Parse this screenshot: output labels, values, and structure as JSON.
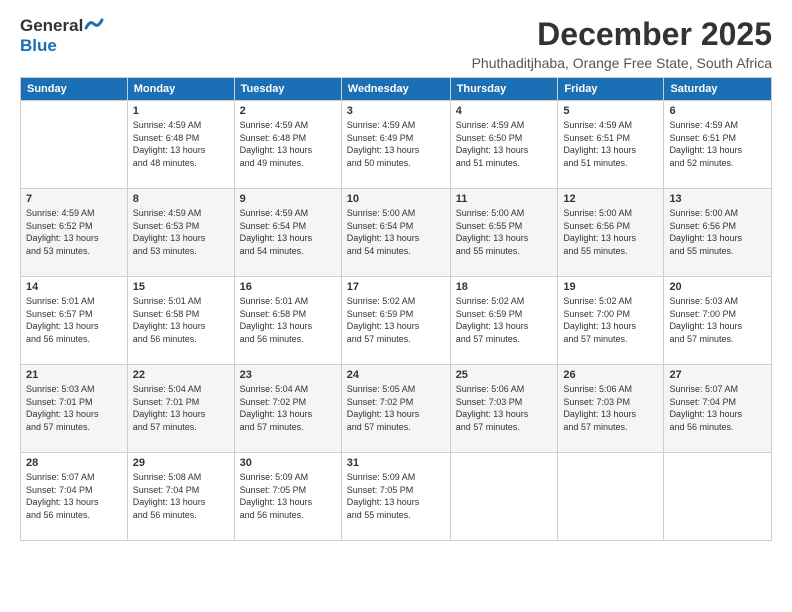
{
  "logo": {
    "general": "General",
    "blue": "Blue"
  },
  "header": {
    "month_year": "December 2025",
    "location": "Phuthaditjhaba, Orange Free State, South Africa"
  },
  "weekdays": [
    "Sunday",
    "Monday",
    "Tuesday",
    "Wednesday",
    "Thursday",
    "Friday",
    "Saturday"
  ],
  "weeks": [
    [
      {
        "day": "",
        "sunrise": "",
        "sunset": "",
        "daylight": ""
      },
      {
        "day": "1",
        "sunrise": "Sunrise: 4:59 AM",
        "sunset": "Sunset: 6:48 PM",
        "daylight": "Daylight: 13 hours and 48 minutes."
      },
      {
        "day": "2",
        "sunrise": "Sunrise: 4:59 AM",
        "sunset": "Sunset: 6:48 PM",
        "daylight": "Daylight: 13 hours and 49 minutes."
      },
      {
        "day": "3",
        "sunrise": "Sunrise: 4:59 AM",
        "sunset": "Sunset: 6:49 PM",
        "daylight": "Daylight: 13 hours and 50 minutes."
      },
      {
        "day": "4",
        "sunrise": "Sunrise: 4:59 AM",
        "sunset": "Sunset: 6:50 PM",
        "daylight": "Daylight: 13 hours and 51 minutes."
      },
      {
        "day": "5",
        "sunrise": "Sunrise: 4:59 AM",
        "sunset": "Sunset: 6:51 PM",
        "daylight": "Daylight: 13 hours and 51 minutes."
      },
      {
        "day": "6",
        "sunrise": "Sunrise: 4:59 AM",
        "sunset": "Sunset: 6:51 PM",
        "daylight": "Daylight: 13 hours and 52 minutes."
      }
    ],
    [
      {
        "day": "7",
        "sunrise": "Sunrise: 4:59 AM",
        "sunset": "Sunset: 6:52 PM",
        "daylight": "Daylight: 13 hours and 53 minutes."
      },
      {
        "day": "8",
        "sunrise": "Sunrise: 4:59 AM",
        "sunset": "Sunset: 6:53 PM",
        "daylight": "Daylight: 13 hours and 53 minutes."
      },
      {
        "day": "9",
        "sunrise": "Sunrise: 4:59 AM",
        "sunset": "Sunset: 6:54 PM",
        "daylight": "Daylight: 13 hours and 54 minutes."
      },
      {
        "day": "10",
        "sunrise": "Sunrise: 5:00 AM",
        "sunset": "Sunset: 6:54 PM",
        "daylight": "Daylight: 13 hours and 54 minutes."
      },
      {
        "day": "11",
        "sunrise": "Sunrise: 5:00 AM",
        "sunset": "Sunset: 6:55 PM",
        "daylight": "Daylight: 13 hours and 55 minutes."
      },
      {
        "day": "12",
        "sunrise": "Sunrise: 5:00 AM",
        "sunset": "Sunset: 6:56 PM",
        "daylight": "Daylight: 13 hours and 55 minutes."
      },
      {
        "day": "13",
        "sunrise": "Sunrise: 5:00 AM",
        "sunset": "Sunset: 6:56 PM",
        "daylight": "Daylight: 13 hours and 55 minutes."
      }
    ],
    [
      {
        "day": "14",
        "sunrise": "Sunrise: 5:01 AM",
        "sunset": "Sunset: 6:57 PM",
        "daylight": "Daylight: 13 hours and 56 minutes."
      },
      {
        "day": "15",
        "sunrise": "Sunrise: 5:01 AM",
        "sunset": "Sunset: 6:58 PM",
        "daylight": "Daylight: 13 hours and 56 minutes."
      },
      {
        "day": "16",
        "sunrise": "Sunrise: 5:01 AM",
        "sunset": "Sunset: 6:58 PM",
        "daylight": "Daylight: 13 hours and 56 minutes."
      },
      {
        "day": "17",
        "sunrise": "Sunrise: 5:02 AM",
        "sunset": "Sunset: 6:59 PM",
        "daylight": "Daylight: 13 hours and 57 minutes."
      },
      {
        "day": "18",
        "sunrise": "Sunrise: 5:02 AM",
        "sunset": "Sunset: 6:59 PM",
        "daylight": "Daylight: 13 hours and 57 minutes."
      },
      {
        "day": "19",
        "sunrise": "Sunrise: 5:02 AM",
        "sunset": "Sunset: 7:00 PM",
        "daylight": "Daylight: 13 hours and 57 minutes."
      },
      {
        "day": "20",
        "sunrise": "Sunrise: 5:03 AM",
        "sunset": "Sunset: 7:00 PM",
        "daylight": "Daylight: 13 hours and 57 minutes."
      }
    ],
    [
      {
        "day": "21",
        "sunrise": "Sunrise: 5:03 AM",
        "sunset": "Sunset: 7:01 PM",
        "daylight": "Daylight: 13 hours and 57 minutes."
      },
      {
        "day": "22",
        "sunrise": "Sunrise: 5:04 AM",
        "sunset": "Sunset: 7:01 PM",
        "daylight": "Daylight: 13 hours and 57 minutes."
      },
      {
        "day": "23",
        "sunrise": "Sunrise: 5:04 AM",
        "sunset": "Sunset: 7:02 PM",
        "daylight": "Daylight: 13 hours and 57 minutes."
      },
      {
        "day": "24",
        "sunrise": "Sunrise: 5:05 AM",
        "sunset": "Sunset: 7:02 PM",
        "daylight": "Daylight: 13 hours and 57 minutes."
      },
      {
        "day": "25",
        "sunrise": "Sunrise: 5:06 AM",
        "sunset": "Sunset: 7:03 PM",
        "daylight": "Daylight: 13 hours and 57 minutes."
      },
      {
        "day": "26",
        "sunrise": "Sunrise: 5:06 AM",
        "sunset": "Sunset: 7:03 PM",
        "daylight": "Daylight: 13 hours and 57 minutes."
      },
      {
        "day": "27",
        "sunrise": "Sunrise: 5:07 AM",
        "sunset": "Sunset: 7:04 PM",
        "daylight": "Daylight: 13 hours and 56 minutes."
      }
    ],
    [
      {
        "day": "28",
        "sunrise": "Sunrise: 5:07 AM",
        "sunset": "Sunset: 7:04 PM",
        "daylight": "Daylight: 13 hours and 56 minutes."
      },
      {
        "day": "29",
        "sunrise": "Sunrise: 5:08 AM",
        "sunset": "Sunset: 7:04 PM",
        "daylight": "Daylight: 13 hours and 56 minutes."
      },
      {
        "day": "30",
        "sunrise": "Sunrise: 5:09 AM",
        "sunset": "Sunset: 7:05 PM",
        "daylight": "Daylight: 13 hours and 56 minutes."
      },
      {
        "day": "31",
        "sunrise": "Sunrise: 5:09 AM",
        "sunset": "Sunset: 7:05 PM",
        "daylight": "Daylight: 13 hours and 55 minutes."
      },
      {
        "day": "",
        "sunrise": "",
        "sunset": "",
        "daylight": ""
      },
      {
        "day": "",
        "sunrise": "",
        "sunset": "",
        "daylight": ""
      },
      {
        "day": "",
        "sunrise": "",
        "sunset": "",
        "daylight": ""
      }
    ]
  ]
}
